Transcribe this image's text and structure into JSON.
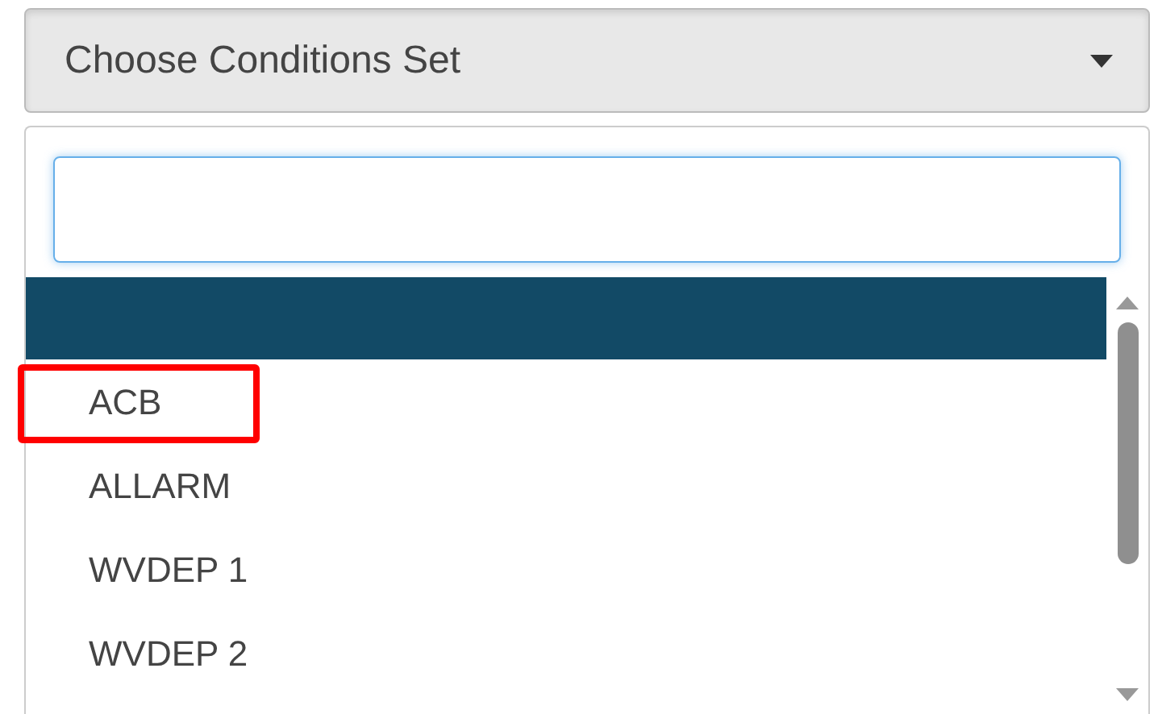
{
  "select": {
    "label": "Choose Conditions Set",
    "expanded": true
  },
  "options": [
    {
      "selected": true
    },
    {
      "label": "ACB",
      "selected": false,
      "annotated": true
    },
    {
      "label": "ALLARM",
      "selected": false,
      "annotated": false
    },
    {
      "label": "WVDEP 1",
      "selected": false,
      "annotated": false
    },
    {
      "label": "WVDEP 2",
      "selected": false,
      "annotated": false
    }
  ]
}
